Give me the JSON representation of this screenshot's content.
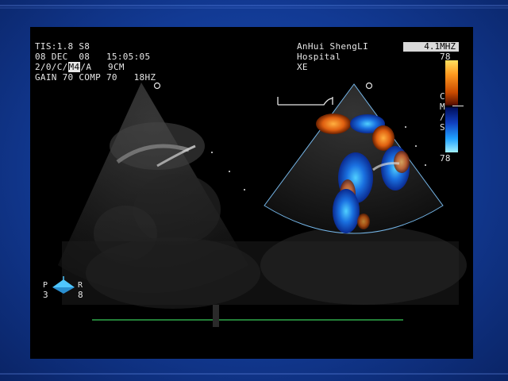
{
  "overlay": {
    "line1": "TIS:1.8 S8",
    "line2": "08 DEC  08   15:05:05",
    "line3_pre": "2/0/C/",
    "line3_box": "M4",
    "line3_post": "/A   9CM",
    "line4": "GAIN 70 COMP 70   18HZ"
  },
  "header_right": {
    "site_line1": "AnHui ShengLI",
    "site_line2": "Hospital",
    "site_line3": "XE",
    "frequency": "4.1MHZ"
  },
  "color_scale": {
    "top_value": "78",
    "bottom_value": "78",
    "unit_letters": [
      "C",
      "M",
      "/",
      "S"
    ],
    "colors": {
      "forward": "#ff9a20",
      "reverse": "#20a0ff"
    }
  },
  "probe_marker": {
    "left_letter": "P",
    "right_letter": "R",
    "left_number": "3",
    "right_number": "8",
    "icon_color": "#4fc6ff"
  },
  "ecg_color": "#2fa84a"
}
